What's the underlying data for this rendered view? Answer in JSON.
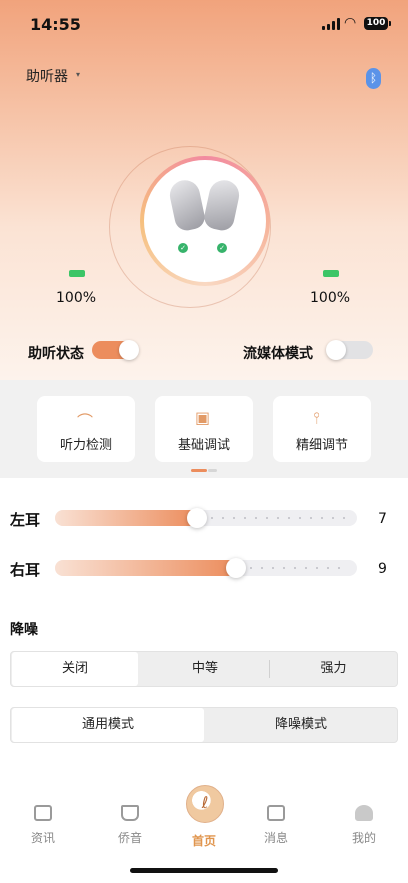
{
  "status_bar": {
    "time": "14:55",
    "battery": "100"
  },
  "header": {
    "device_name": "助听器"
  },
  "devices": {
    "left_battery": "100%",
    "right_battery": "100%"
  },
  "toggles": {
    "hearing_state": {
      "label": "助听状态",
      "on": true
    },
    "streaming_mode": {
      "label": "流媒体模式",
      "on": false
    }
  },
  "function_cards": [
    {
      "label": "听力检测",
      "icon": "ear-icon"
    },
    {
      "label": "基础调试",
      "icon": "easel-icon"
    },
    {
      "label": "精细调节",
      "icon": "sliders-icon"
    }
  ],
  "volume": {
    "left": {
      "label": "左耳",
      "value": "7",
      "fraction": 0.47
    },
    "right": {
      "label": "右耳",
      "value": "9",
      "fraction": 0.6
    }
  },
  "noise_reduction": {
    "title": "降噪",
    "options": [
      "关闭",
      "中等",
      "强力"
    ],
    "selected": "关闭"
  },
  "mode": {
    "options": [
      "通用模式",
      "降噪模式"
    ],
    "selected": "通用模式"
  },
  "tabs": [
    {
      "label": "资讯",
      "icon": "news-icon"
    },
    {
      "label": "侨音",
      "icon": "cart-icon"
    },
    {
      "label": "首页",
      "icon": "home-logo-icon",
      "active": true
    },
    {
      "label": "消息",
      "icon": "message-icon"
    },
    {
      "label": "我的",
      "icon": "profile-icon"
    }
  ],
  "colors": {
    "accent": "#ec8d5d",
    "active_tab": "#e0954e",
    "bluetooth": "#5b93e8",
    "battery_level": "#3cc566"
  }
}
